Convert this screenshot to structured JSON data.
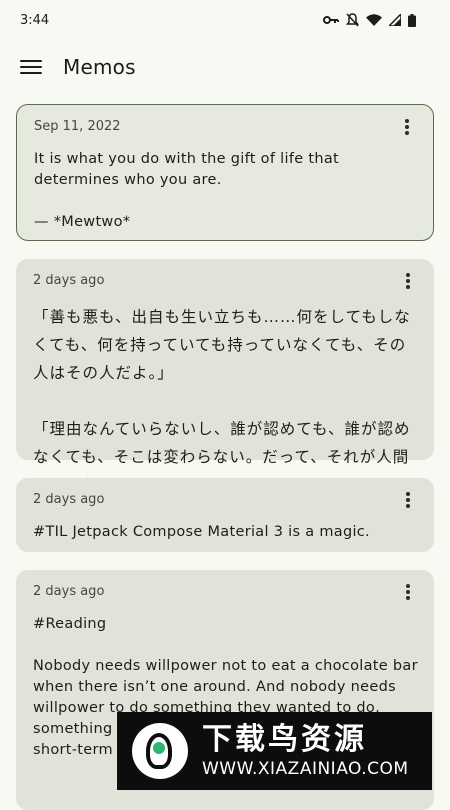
{
  "status_bar": {
    "time": "3:44"
  },
  "app_bar": {
    "title": "Memos"
  },
  "memos": [
    {
      "date": "Sep 11, 2022",
      "body": "It is what you do with the gift of life that determines who you are.\n\n— *Mewtwo*"
    },
    {
      "date": "2 days ago",
      "body": "「善も悪も、出自も生い立ちも……何をしてもしなくても、何を持っていても持っていなくても、その人はその人だよ。」\n\n「理由なんていらないし、誰が認めても、誰が認めなくても、そこは変わらない。だって、それが人間でしょう?」"
    },
    {
      "date": "2 days ago",
      "body": "#TIL Jetpack Compose Material 3 is a magic."
    },
    {
      "date": "2 days ago",
      "body": "#Reading\n\nNobody needs willpower not to eat a chocolate bar when there isn’t one around. And nobody needs willpower to do something they wanted to do, something interesting to be done, but long-and short-term interests. Having a"
    }
  ],
  "watermark": {
    "title": "下载鸟资源",
    "url": "WWW.XIAZAINIAO.COM"
  },
  "colors": {
    "background": "#f9f9f4",
    "card": "#dfe3d8",
    "selected_border": "#5a6b4f"
  }
}
